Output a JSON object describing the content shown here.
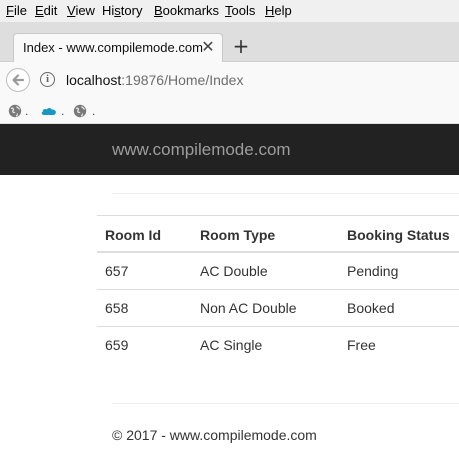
{
  "menu": {
    "items": [
      {
        "u": "F",
        "rest": "ile"
      },
      {
        "u": "E",
        "rest": "dit"
      },
      {
        "u": "V",
        "rest": "iew"
      },
      {
        "u": "",
        "pre": "Hi",
        "mid": "s",
        "rest": "tory"
      },
      {
        "u": "B",
        "rest": "ookmarks"
      },
      {
        "u": "T",
        "rest": "ools"
      },
      {
        "u": "H",
        "rest": "elp"
      }
    ]
  },
  "tab": {
    "title": "Index - www.compilemode.com",
    "close": "✕",
    "new_tab": "+"
  },
  "address": {
    "host": "localhost",
    "path": ":19876/Home/Index"
  },
  "bookmarks": {
    "items": [
      {
        "icon": "globe-icon",
        "label": "."
      },
      {
        "icon": "cloud-icon",
        "label": ".",
        "color": "#1798c1"
      },
      {
        "icon": "globe-icon",
        "label": "."
      }
    ]
  },
  "site": {
    "brand": "www.compilemode.com"
  },
  "table": {
    "headers": [
      "Room Id",
      "Room Type",
      "Booking Status"
    ],
    "rows": [
      [
        "657",
        "AC Double",
        "Pending"
      ],
      [
        "658",
        "Non AC Double",
        "Booked"
      ],
      [
        "659",
        "AC Single",
        "Free"
      ]
    ]
  },
  "footer": {
    "text": "© 2017 - www.compilemode.com"
  }
}
